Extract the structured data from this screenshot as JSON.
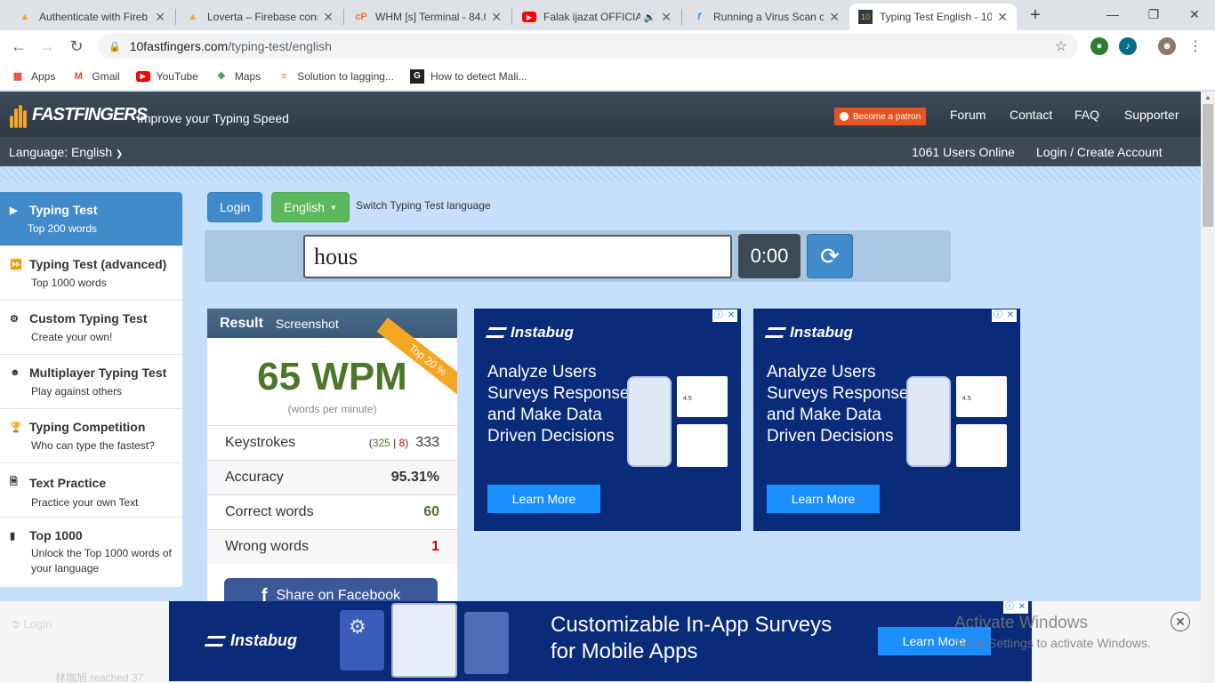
{
  "browser": {
    "tabs": [
      {
        "title": "Authenticate with Fireb",
        "icon": "firebase-icon",
        "active": false
      },
      {
        "title": "Loverta – Firebase cons",
        "icon": "firebase-icon",
        "active": false
      },
      {
        "title": "WHM [s] Terminal - 84.0",
        "icon": "cpanel-icon",
        "active": false
      },
      {
        "title": "Falak ijazat OFFICIA",
        "icon": "youtube-icon",
        "active": false
      },
      {
        "title": "Running a Virus Scan o",
        "icon": "wordpress-icon",
        "active": false
      },
      {
        "title": "Typing Test English - 10",
        "icon": "10ff-icon",
        "active": true
      }
    ],
    "url_domain": "10fastfingers.com",
    "url_path": "/typing-test/english",
    "bookmarks": [
      {
        "label": "Apps",
        "icon": "apps-grid-icon"
      },
      {
        "label": "Gmail",
        "icon": "gmail-icon"
      },
      {
        "label": "YouTube",
        "icon": "youtube-icon"
      },
      {
        "label": "Maps",
        "icon": "maps-icon"
      },
      {
        "label": "Solution to lagging...",
        "icon": "stack-overflow-icon"
      },
      {
        "label": "How to detect Mali...",
        "icon": "g-icon"
      }
    ]
  },
  "site": {
    "logo_text": "FASTFINGERS",
    "slogan": "Improve your Typing Speed",
    "patron_label": "Become a patron",
    "nav": [
      "Forum",
      "Contact",
      "FAQ",
      "Supporter"
    ],
    "language_label": "Language: English",
    "users_online": "1061 Users Online",
    "login_link": "Login / Create Account"
  },
  "sidebar": {
    "items": [
      {
        "title": "Typing Test",
        "subtitle": "Top 200 words",
        "icon": "play-icon",
        "active": true
      },
      {
        "title": "Typing Test (advanced)",
        "subtitle": "Top 1000 words",
        "icon": "fast-forward-icon",
        "active": false
      },
      {
        "title": "Custom Typing Test",
        "subtitle": "Create your own!",
        "icon": "gears-icon",
        "active": false
      },
      {
        "title": "Multiplayer Typing Test",
        "subtitle": "Play against others",
        "icon": "users-icon",
        "active": false
      },
      {
        "title": "Typing Competition",
        "subtitle": "Who can type the fastest?",
        "icon": "trophy-icon",
        "active": false
      },
      {
        "title": "Text Practice",
        "subtitle": "Practice your own Text",
        "icon": "document-icon",
        "active": false
      },
      {
        "title": "Top 1000",
        "subtitle": "Unlock the Top 1000 words of your language",
        "icon": "bar-chart-icon",
        "active": false
      }
    ]
  },
  "controls": {
    "login_button": "Login",
    "language_button": "English",
    "switch_text": "Switch Typing Test language",
    "input_value": "hous",
    "timer": "0:00"
  },
  "result": {
    "title": "Result",
    "screenshot_tab": "Screenshot",
    "ribbon": "Top 20 %",
    "wpm": "65 WPM",
    "wpm_label": "(words per minute)",
    "keystrokes_label": "Keystrokes",
    "keystrokes_correct": "325",
    "keystrokes_wrong": "8",
    "keystrokes_total": "333",
    "accuracy_label": "Accuracy",
    "accuracy_value": "95.31%",
    "correct_label": "Correct words",
    "correct_value": "60",
    "wrong_label": "Wrong words",
    "wrong_value": "1",
    "share_label": "Share on Facebook"
  },
  "ads": {
    "brand": "Instabug",
    "side_copy": "Analyze Users Surveys Response and Make Data Driven Decisions",
    "side_cta": "Learn More",
    "side_rating": "4.5",
    "bottom_copy_line1": "Customizable In-App Surveys",
    "bottom_copy_line2": "for Mobile Apps",
    "bottom_cta": "Learn More"
  },
  "footer_faded": {
    "login": "Login",
    "user_text": "林珈旭 reached 37"
  },
  "windows_watermark": {
    "line1": "Activate Windows",
    "line2": "Go to Settings to activate Windows."
  },
  "colors": {
    "primary_blue": "#428bca",
    "success_green": "#5cb85c",
    "wpm_green": "#4c7729",
    "ad_navy": "#0a2a7a",
    "ad_cta": "#1b8fff",
    "patron_orange": "#e9531f"
  }
}
